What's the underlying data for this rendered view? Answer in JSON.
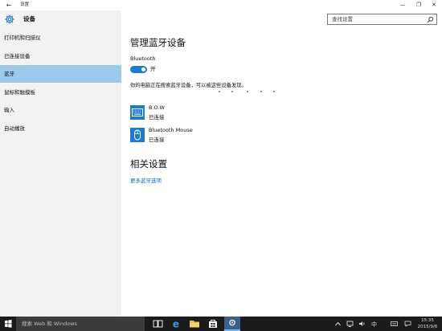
{
  "window": {
    "title": "设置",
    "back_icon": "back-arrow-icon",
    "controls": [
      "minimize-icon",
      "maximize-icon",
      "close-icon"
    ]
  },
  "sidebar": {
    "header_label": "设备",
    "header_icon": "gear-icon",
    "items": [
      {
        "label": "打印机和扫描仪",
        "active": false
      },
      {
        "label": "已连接设备",
        "active": false
      },
      {
        "label": "蓝牙",
        "active": true
      },
      {
        "label": "鼠标和触摸板",
        "active": false
      },
      {
        "label": "输入",
        "active": false
      },
      {
        "label": "自动播放",
        "active": false
      }
    ]
  },
  "search": {
    "placeholder": "查找设置",
    "icon": "search-icon"
  },
  "main": {
    "title": "管理蓝牙设备",
    "bluetooth_label": "Bluetooth",
    "toggle_state": "开",
    "scan_text": "你的电脑正在搜索蓝牙设备，可以被这些设备发现。",
    "devices": [
      {
        "name": "B.O.W",
        "status": "已连接",
        "icon": "keyboard-icon"
      },
      {
        "name": "Bluetooth Mouse",
        "status": "已连接",
        "icon": "mouse-icon"
      }
    ],
    "related_title": "相关设置",
    "related_link": "更多蓝牙选项"
  },
  "taskbar": {
    "search_text": "搜索 Web 和 Windows",
    "apps": [
      "task-view-icon",
      "edge-icon",
      "file-explorer-icon",
      "store-icon",
      "settings-icon"
    ],
    "active_app": "settings-icon",
    "tray": [
      "chevron-up-icon",
      "network-icon",
      "volume-icon",
      "ime-icon",
      "keyboard-tray-icon",
      "notification-icon"
    ],
    "time": "15:35",
    "date": "2015/9/6"
  },
  "colors": {
    "accent": "#1d7bd0",
    "sidebar_active": "#9dc9ea",
    "sidebar_bg": "#f2f2f2",
    "taskbar_bg": "#1b1b1b",
    "link": "#1565c0"
  }
}
